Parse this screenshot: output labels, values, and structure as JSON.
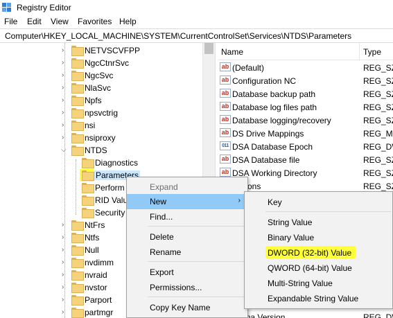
{
  "window": {
    "title": "Registry Editor",
    "icon": "registry-editor-icon"
  },
  "menubar": [
    "File",
    "Edit",
    "View",
    "Favorites",
    "Help"
  ],
  "address": {
    "path": "Computer\\HKEY_LOCAL_MACHINE\\SYSTEM\\CurrentControlSet\\Services\\NTDS\\Parameters"
  },
  "tree": {
    "items": [
      {
        "label": "NETVSCVFPP",
        "expanded": false
      },
      {
        "label": "NgcCtnrSvc",
        "expanded": false
      },
      {
        "label": "NgcSvc",
        "expanded": false
      },
      {
        "label": "NlaSvc",
        "expanded": false
      },
      {
        "label": "Npfs",
        "expanded": false
      },
      {
        "label": "npsvctrig",
        "expanded": false
      },
      {
        "label": "nsi",
        "expanded": false
      },
      {
        "label": "nsiproxy",
        "expanded": false
      },
      {
        "label": "NTDS",
        "expanded": true
      },
      {
        "label": "Diagnostics"
      },
      {
        "label": "Parameters",
        "selected": true,
        "highlighted": true
      },
      {
        "label": "Perform"
      },
      {
        "label": "RID Valu"
      },
      {
        "label": "Security"
      },
      {
        "label": "NtFrs",
        "expanded": false
      },
      {
        "label": "Ntfs",
        "expanded": false
      },
      {
        "label": "Null",
        "expanded": false
      },
      {
        "label": "nvdimm",
        "expanded": false
      },
      {
        "label": "nvraid",
        "expanded": false
      },
      {
        "label": "nvstor",
        "expanded": false
      },
      {
        "label": "Parport",
        "expanded": false
      },
      {
        "label": "partmgr",
        "expanded": false
      }
    ]
  },
  "list": {
    "columns": {
      "name": "Name",
      "type": "Type"
    },
    "rows": [
      {
        "name": "(Default)",
        "type": "REG_SZ",
        "icon": "string"
      },
      {
        "name": "Configuration NC",
        "type": "REG_SZ",
        "icon": "string"
      },
      {
        "name": "Database backup path",
        "type": "REG_SZ",
        "icon": "string"
      },
      {
        "name": "Database log files path",
        "type": "REG_SZ",
        "icon": "string"
      },
      {
        "name": "Database logging/recovery",
        "type": "REG_SZ",
        "icon": "string"
      },
      {
        "name": "DS Drive Mappings",
        "type": "REG_MU",
        "icon": "string"
      },
      {
        "name": "DSA Database Epoch",
        "type": "REG_DW",
        "icon": "binary"
      },
      {
        "name": "DSA Database file",
        "type": "REG_SZ",
        "icon": "string"
      },
      {
        "name": "DSA Working Directory",
        "type": "REG_SZ",
        "icon": "string"
      },
      {
        "name": "Options",
        "type": "REG_SZ",
        "icon": "string"
      }
    ],
    "partial_bottom": {
      "name": "...Schema Version",
      "type": "REG_DW"
    }
  },
  "context_menu": {
    "items": [
      {
        "label": "Expand",
        "disabled": true
      },
      {
        "label": "New",
        "hover": true,
        "submenu_arrow": "›"
      },
      {
        "label": "Find..."
      },
      {
        "label": "Delete"
      },
      {
        "label": "Rename"
      },
      {
        "label": "Export"
      },
      {
        "label": "Permissions..."
      },
      {
        "label": "Copy Key Name"
      }
    ]
  },
  "submenu": {
    "items": [
      {
        "label": "Key"
      },
      {
        "label": "String Value"
      },
      {
        "label": "Binary Value"
      },
      {
        "label": "DWORD (32-bit) Value",
        "highlighted": true
      },
      {
        "label": "QWORD (64-bit) Value"
      },
      {
        "label": "Multi-String Value"
      },
      {
        "label": "Expandable String Value"
      }
    ]
  },
  "colors": {
    "highlight": "#ffff3a",
    "selection": "#cce8ff",
    "menu_hover": "#91c9f7",
    "menu_bg": "#f2f2f2"
  }
}
